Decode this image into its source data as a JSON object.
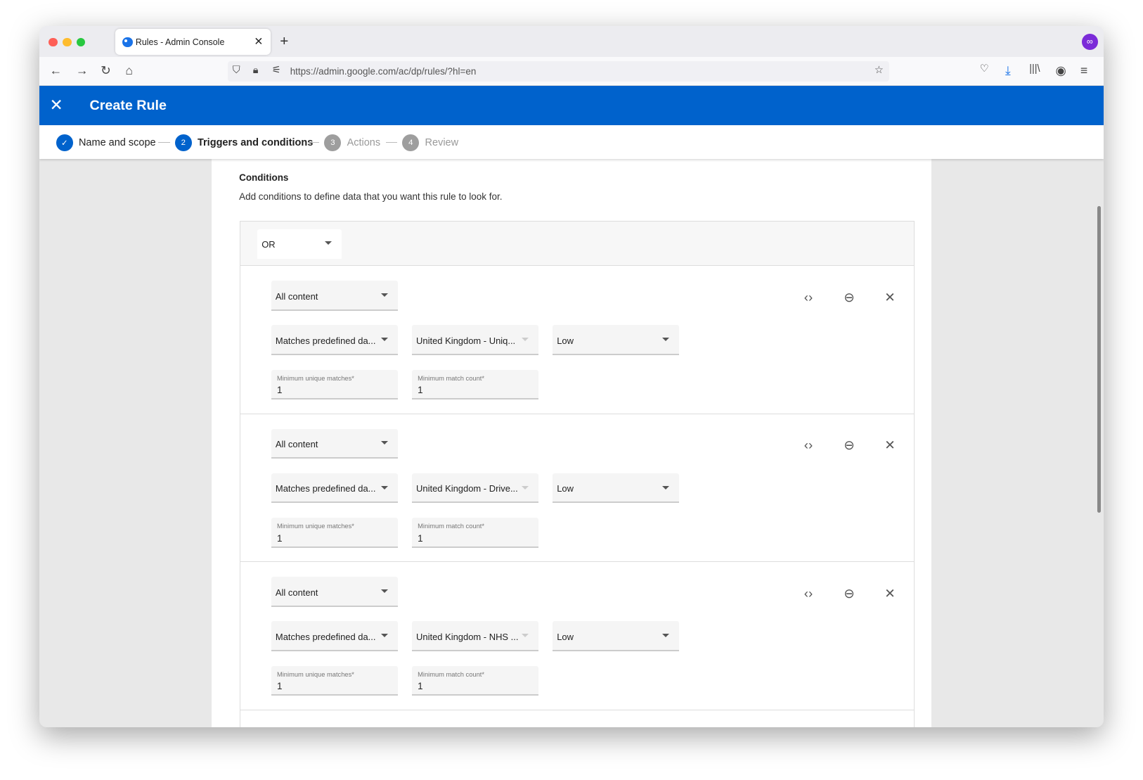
{
  "browser": {
    "tab_title": "Rules - Admin Console",
    "url": "https://admin.google.com/ac/dp/rules/?hl=en"
  },
  "header": {
    "title": "Create Rule"
  },
  "stepper": [
    {
      "num": "✓",
      "label": "Name and scope",
      "state": "done"
    },
    {
      "num": "2",
      "label": "Triggers and conditions",
      "state": "active"
    },
    {
      "num": "3",
      "label": "Actions",
      "state": "pending"
    },
    {
      "num": "4",
      "label": "Review",
      "state": "pending"
    }
  ],
  "conditions": {
    "heading": "Conditions",
    "description": "Add conditions to define data that you want this rule to look for.",
    "operator": "OR",
    "rows": [
      {
        "scope": "All content",
        "match_type": "Matches predefined da...",
        "detector": "United Kingdom - Uniq...",
        "likelihood": "Low",
        "min_unique_label": "Minimum unique matches*",
        "min_unique": "1",
        "min_count_label": "Minimum match count*",
        "min_count": "1"
      },
      {
        "scope": "All content",
        "match_type": "Matches predefined da...",
        "detector": "United Kingdom - Drive...",
        "likelihood": "Low",
        "min_unique_label": "Minimum unique matches*",
        "min_unique": "1",
        "min_count_label": "Minimum match count*",
        "min_count": "1"
      },
      {
        "scope": "All content",
        "match_type": "Matches predefined da...",
        "detector": "United Kingdom - NHS ...",
        "likelihood": "Low",
        "min_unique_label": "Minimum unique matches*",
        "min_unique": "1",
        "min_count_label": "Minimum match count*",
        "min_count": "1"
      }
    ]
  },
  "colors": {
    "brand": "#0062cc",
    "pending": "#9e9e9e"
  }
}
